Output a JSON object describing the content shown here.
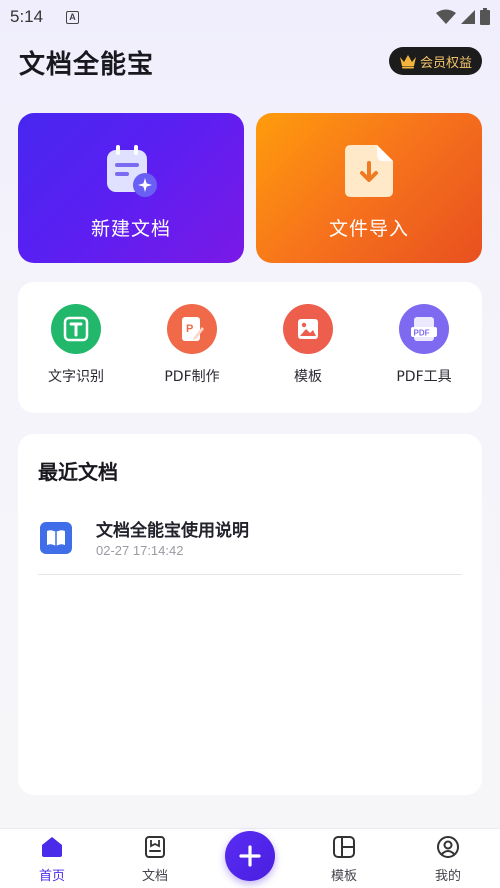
{
  "status_bar": {
    "time": "5:14",
    "notification_letter": "A"
  },
  "header": {
    "title": "文档全能宝",
    "member_label": "会员权益"
  },
  "actions": {
    "new_doc": "新建文档",
    "import_file": "文件导入"
  },
  "tools": [
    {
      "label": "文字识别",
      "icon": "text-recognition-icon",
      "color": "#22b86c"
    },
    {
      "label": "PDF制作",
      "icon": "pdf-edit-icon",
      "color": "#f06a4a"
    },
    {
      "label": "模板",
      "icon": "image-template-icon",
      "color": "#ee5e4c"
    },
    {
      "label": "PDF工具",
      "icon": "pdf-file-icon",
      "color": "#7d6af0"
    }
  ],
  "recent": {
    "title": "最近文档",
    "documents": [
      {
        "name": "文档全能宝使用说明",
        "time": "02-27 17:14:42"
      }
    ]
  },
  "nav": {
    "home": "首页",
    "docs": "文档",
    "templates": "模板",
    "mine": "我的"
  },
  "colors": {
    "accent": "#4b2bea",
    "card_new": "#5a1ff2",
    "card_import": "#f6721c"
  }
}
